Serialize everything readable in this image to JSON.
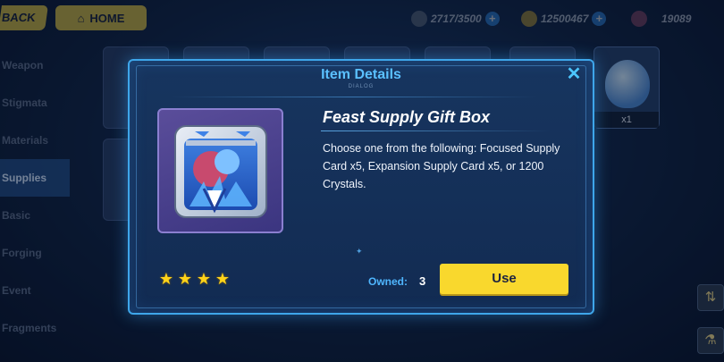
{
  "topbar": {
    "back_label": "BACK",
    "home_label": "HOME",
    "stamina": "2717/3500",
    "coins": "12500467",
    "crystals": "19089"
  },
  "sidebar": {
    "items": [
      "Weapon",
      "Stigmata",
      "Materials",
      "Supplies",
      "Basic",
      "Forging",
      "Event",
      "Fragments"
    ],
    "active_index": 3
  },
  "inventory": {
    "right_card_count": "x1"
  },
  "dialog": {
    "title": "Item Details",
    "subtitle": "DIALOG",
    "close_glyph": "✕",
    "item_name": "Feast Supply Gift Box",
    "description": "Choose one from the following: Focused Supply Card x5, Expansion Supply Card x5, or 1200 Crystals.",
    "rarity_stars": 4,
    "owned_label": "Owned:",
    "owned_value": "3",
    "use_label": "Use"
  },
  "colors": {
    "accent": "#3ea6ea",
    "title": "#5bc0ff",
    "button": "#f9d82d",
    "star": "#ffd319"
  },
  "icons": {
    "home": "home-icon",
    "stamina": "lightning-icon",
    "coins": "coin-icon",
    "crystals": "crystal-icon",
    "close": "close-icon",
    "star": "star-icon"
  }
}
